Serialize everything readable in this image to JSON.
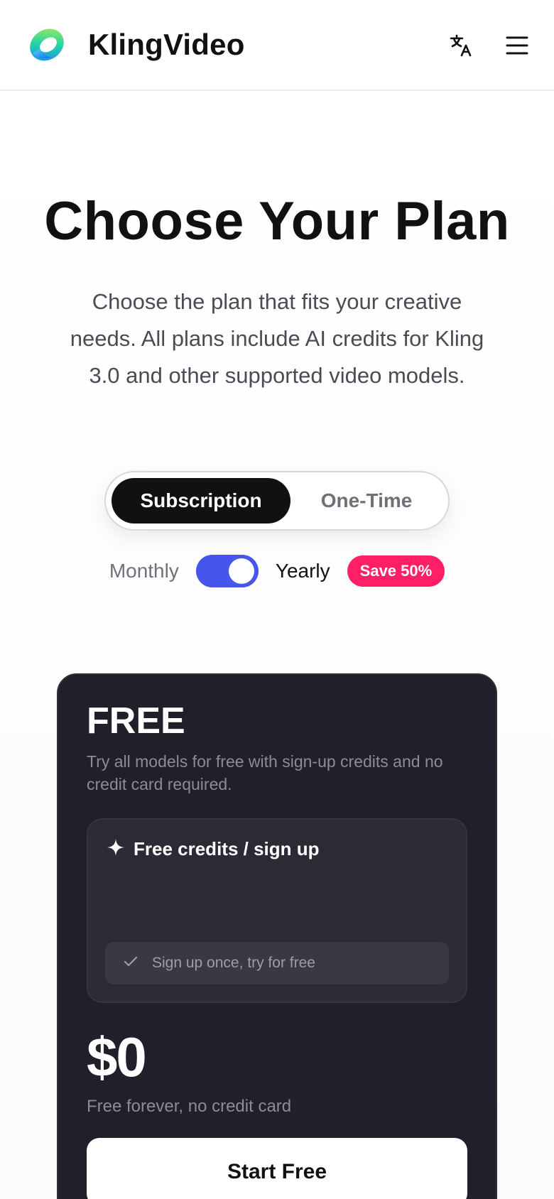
{
  "header": {
    "brand": "KlingVideo",
    "icons": [
      "logo-icon",
      "translate-icon",
      "menu-icon"
    ]
  },
  "hero": {
    "title": "Choose Your Plan",
    "subtitle": "Choose the plan that fits your creative needs. All plans include AI credits for Kling 3.0 and other supported video models."
  },
  "plan_type": {
    "options": [
      "Subscription",
      "One-Time"
    ],
    "selected": "Subscription"
  },
  "billing": {
    "monthly_label": "Monthly",
    "yearly_label": "Yearly",
    "yearly_selected": true,
    "badge": "Save 50%"
  },
  "free_plan": {
    "name": "FREE",
    "description": "Try all models for free with sign-up credits and no credit card required.",
    "credits_title": "Free credits / sign up",
    "credit_row": "Sign up once, try for free",
    "price": "$0",
    "price_note": "Free forever, no credit card",
    "cta": "Start Free"
  },
  "colors": {
    "accent": "#4655eb",
    "badge": "#ff1f66",
    "card_bg": "#1f2029"
  }
}
